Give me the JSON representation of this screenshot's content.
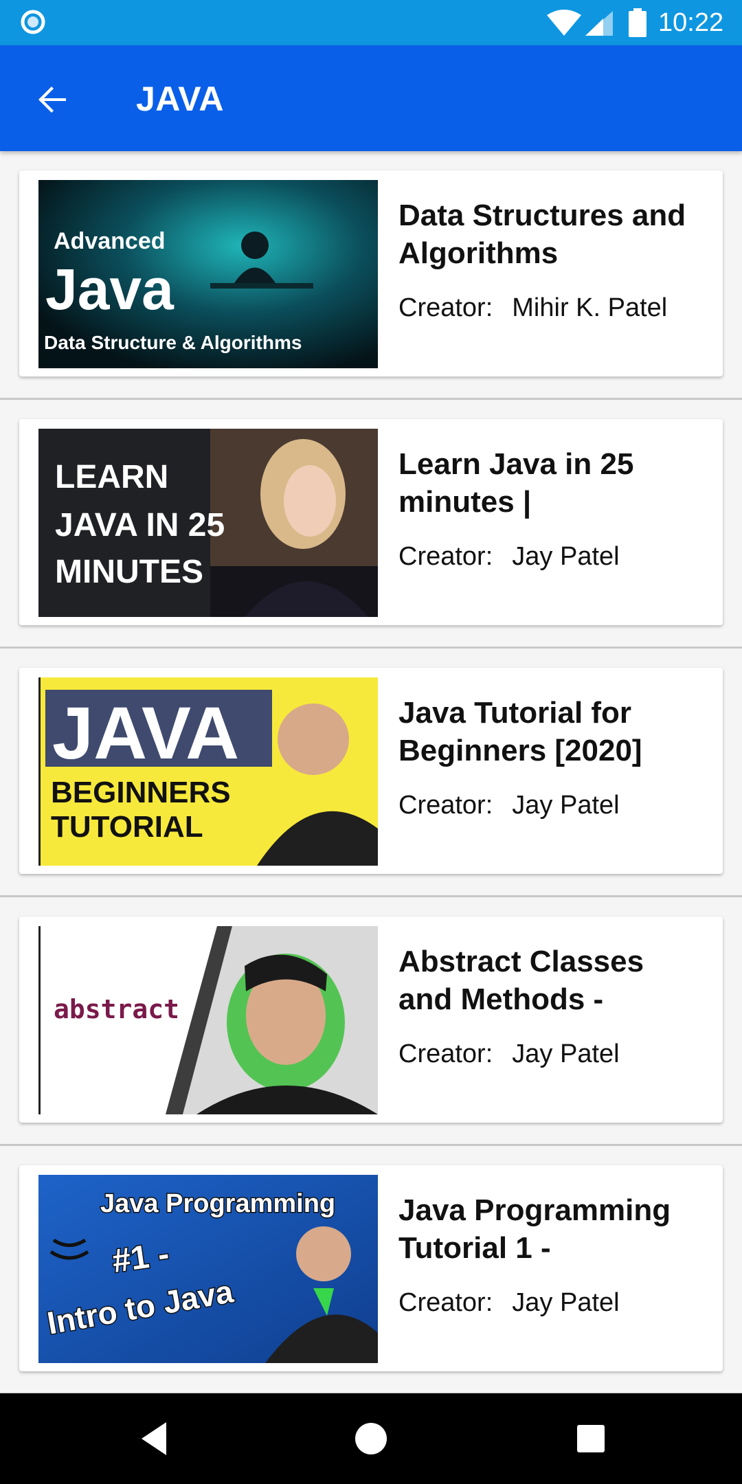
{
  "status_bar": {
    "time": "10:22"
  },
  "app_bar": {
    "title": "JAVA"
  },
  "creator_label": "Creator:",
  "courses": [
    {
      "title": "Data Structures and Algorithms",
      "creator": "Mihir K. Patel",
      "thumb_text": [
        "Advanced",
        "Java",
        "Data Structure & Algorithms"
      ]
    },
    {
      "title": "Learn Java in 25 minutes |",
      "creator": "Jay Patel",
      "thumb_text": [
        "LEARN",
        "JAVA IN 25",
        "MINUTES"
      ]
    },
    {
      "title": "Java Tutorial for Beginners [2020]",
      "creator": "Jay Patel",
      "thumb_text": [
        "JAVA",
        "BEGINNERS",
        "TUTORIAL"
      ]
    },
    {
      "title": "Abstract Classes and Methods -",
      "creator": "Jay Patel",
      "thumb_text": [
        "abstract"
      ]
    },
    {
      "title": "Java Programming Tutorial 1 -",
      "creator": "Jay Patel",
      "thumb_text": [
        "Java Programming",
        "#1 -",
        "Intro to Java"
      ]
    }
  ],
  "colors": {
    "status_bar": "#0f96e0",
    "app_bar": "#0a5fe8",
    "nav_bar": "#000000"
  }
}
